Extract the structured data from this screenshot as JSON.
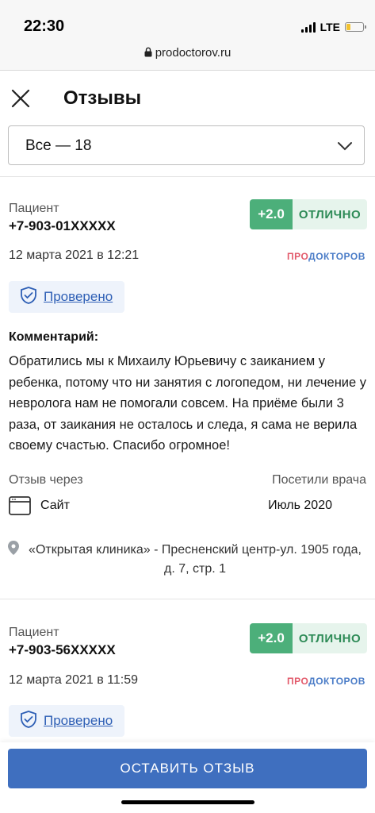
{
  "status_bar": {
    "time": "22:30",
    "network": "LTE"
  },
  "browser": {
    "url": "prodoctorov.ru"
  },
  "header": {
    "title": "Отзывы"
  },
  "filter": {
    "selected": "Все — 18"
  },
  "reviews": [
    {
      "patient_label": "Пациент",
      "phone": "+7-903-01XXXXX",
      "rating_score": "+2.0",
      "rating_word": "ОТЛИЧНО",
      "date": "12 марта 2021 в 12:21",
      "brand_part1": "ПРО",
      "brand_part2": "ДОКТОРОВ",
      "verified_label": "Проверено",
      "comment_heading": "Комментарий:",
      "comment_text": "Обратились мы к Михаилу Юрьевичу с заиканием у ребенка, потому что ни занятия с логопедом, ни лечение у невролога нам не помогали совсем. На приёме были 3 раза, от заикания не осталось и следа, я сама не верила своему счастью. Спасибо огромное!",
      "via_label": "Отзыв через",
      "via_value": "Сайт",
      "visit_label": "Посетили врача",
      "visit_value": "Июль 2020",
      "address": "«Открытая клиника» - Пресненский центр-ул. 1905 года, д. 7, стр. 1"
    },
    {
      "patient_label": "Пациент",
      "phone": "+7-903-56XXXXX",
      "rating_score": "+2.0",
      "rating_word": "ОТЛИЧНО",
      "date": "12 марта 2021 в 11:59",
      "brand_part1": "ПРО",
      "brand_part2": "ДОКТОРОВ",
      "verified_label": "Проверено"
    }
  ],
  "cta": {
    "label": "ОСТАВИТЬ ОТЗЫВ"
  },
  "colors": {
    "accent": "#3f6fbf",
    "rating_green": "#4caf7a",
    "rating_bg": "#e6f4ec"
  }
}
